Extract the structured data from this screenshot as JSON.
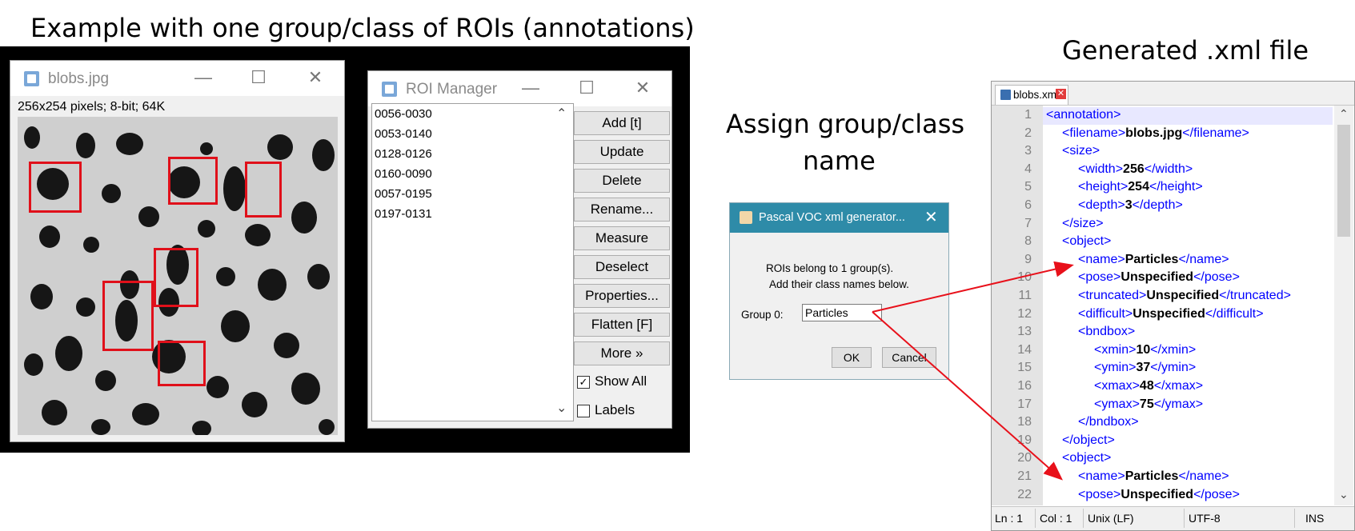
{
  "captions": {
    "left": "Example with one group/class of ROIs (annotations)",
    "middle_line1": "Assign group/class",
    "middle_line2": "name",
    "right": "Generated .xml file"
  },
  "image_window": {
    "title": "blobs.jpg",
    "info": "256x254 pixels; 8-bit; 64K",
    "controls": [
      "—",
      "☐",
      "✕"
    ]
  },
  "roi_manager": {
    "title": "ROI Manager",
    "controls": [
      "—",
      "☐",
      "✕"
    ],
    "rois": [
      "0056-0030",
      "0053-0140",
      "0128-0126",
      "0160-0090",
      "0057-0195",
      "0197-0131"
    ],
    "buttons": [
      "Add [t]",
      "Update",
      "Delete",
      "Rename...",
      "Measure",
      "Deselect",
      "Properties...",
      "Flatten [F]",
      "More »"
    ],
    "show_all": {
      "label": "Show All",
      "checked": true
    },
    "labels": {
      "label": "Labels",
      "checked": false
    }
  },
  "dialog": {
    "title": "Pascal VOC xml generator...",
    "line1": "ROIs belong to 1 group(s).",
    "line2": "Add their class names below.",
    "field_label": "Group 0:",
    "field_value": "Particles",
    "ok": "OK",
    "cancel": "Cancel"
  },
  "editor": {
    "tab_name": "blobs.xml",
    "lines": [
      {
        "n": "1",
        "open": "<annotation>",
        "val": "",
        "close": ""
      },
      {
        "n": "2",
        "open": "<filename>",
        "val": "blobs.jpg",
        "close": "</filename>"
      },
      {
        "n": "3",
        "open": "<size>",
        "val": "",
        "close": ""
      },
      {
        "n": "4",
        "open": "<width>",
        "val": "256",
        "close": "</width>"
      },
      {
        "n": "5",
        "open": "<height>",
        "val": "254",
        "close": "</height>"
      },
      {
        "n": "6",
        "open": "<depth>",
        "val": "3",
        "close": "</depth>"
      },
      {
        "n": "7",
        "open": "</size>",
        "val": "",
        "close": ""
      },
      {
        "n": "8",
        "open": "<object>",
        "val": "",
        "close": ""
      },
      {
        "n": "9",
        "open": "<name>",
        "val": "Particles",
        "close": "</name>"
      },
      {
        "n": "10",
        "open": "<pose>",
        "val": "Unspecified",
        "close": "</pose>"
      },
      {
        "n": "11",
        "open": "<truncated>",
        "val": "Unspecified",
        "close": "</truncated>"
      },
      {
        "n": "12",
        "open": "<difficult>",
        "val": "Unspecified",
        "close": "</difficult>"
      },
      {
        "n": "13",
        "open": "<bndbox>",
        "val": "",
        "close": ""
      },
      {
        "n": "14",
        "open": "<xmin>",
        "val": "10",
        "close": "</xmin>"
      },
      {
        "n": "15",
        "open": "<ymin>",
        "val": "37",
        "close": "</ymin>"
      },
      {
        "n": "16",
        "open": "<xmax>",
        "val": "48",
        "close": "</xmax>"
      },
      {
        "n": "17",
        "open": "<ymax>",
        "val": "75",
        "close": "</ymax>"
      },
      {
        "n": "18",
        "open": "</bndbox>",
        "val": "",
        "close": ""
      },
      {
        "n": "19",
        "open": "</object>",
        "val": "",
        "close": ""
      },
      {
        "n": "20",
        "open": "<object>",
        "val": "",
        "close": ""
      },
      {
        "n": "21",
        "open": "<name>",
        "val": "Particles",
        "close": "</name>"
      },
      {
        "n": "22",
        "open": "<pose>",
        "val": "Unspecified",
        "close": "</pose>"
      }
    ],
    "status": {
      "ln": "Ln : 1",
      "col": "Col : 1",
      "eol": "Unix (LF)",
      "enc": "UTF-8",
      "mode": "INS"
    }
  },
  "colors": {
    "roi": "#e0101a",
    "arrow": "#e8101a",
    "xml_tag": "#0000ff",
    "dialog_title": "#2e8ba8"
  }
}
